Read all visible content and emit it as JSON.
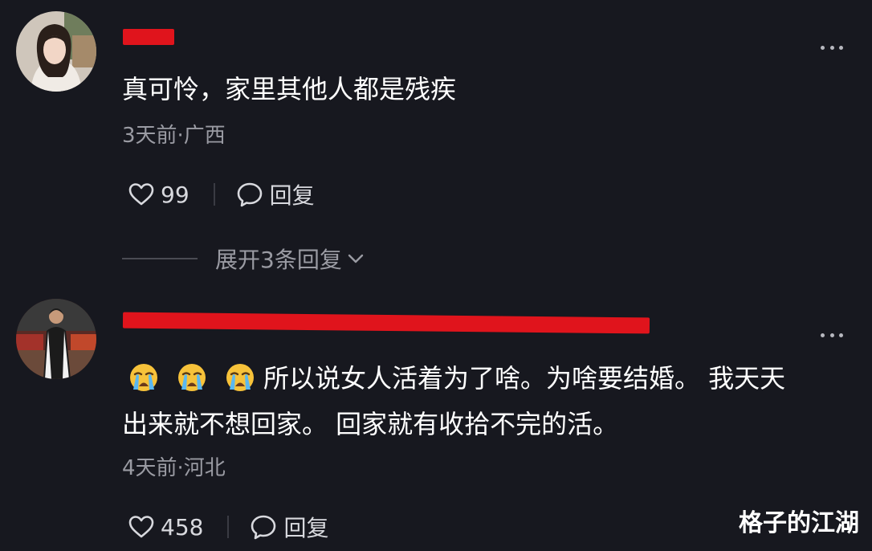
{
  "comments": [
    {
      "text": "真可怜，家里其他人都是残疾",
      "meta": "3天前·广西",
      "likes": "99",
      "reply_label": "回复",
      "expand_label": "展开3条回复",
      "expand_icon": "chevron-down-icon"
    },
    {
      "emojis": [
        "loudly-crying-face",
        "loudly-crying-face",
        "loudly-crying-face"
      ],
      "text_line1": "所以说女人活着为了啥。为啥要结婚。 我天天",
      "text_line2": "出来就不想回家。 回家就有收拾不完的活。",
      "meta": "4天前·河北",
      "likes": "458",
      "reply_label": "回复"
    }
  ],
  "watermark": "格子的江湖",
  "colors": {
    "background": "#17181f",
    "primary_text": "#ffffff",
    "secondary_text": "#9a9ba3",
    "redaction": "#e0141c"
  }
}
